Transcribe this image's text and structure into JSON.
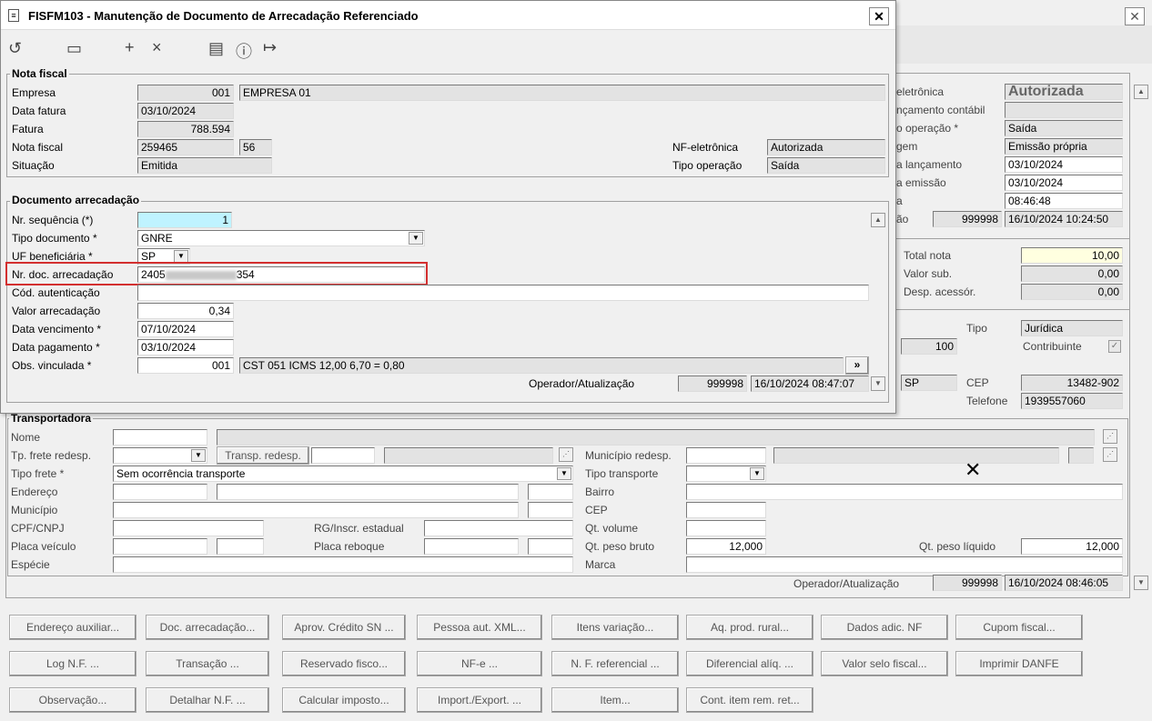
{
  "dialog": {
    "title": "FISFM103 - Manutenção de Documento de Arrecadação Referenciado"
  },
  "nf": {
    "title": "Nota fiscal",
    "empresa_label": "Empresa",
    "empresa_code": "001",
    "empresa_name": "EMPRESA 01",
    "data_fatura_label": "Data fatura",
    "data_fatura": "03/10/2024",
    "fatura_label": "Fatura",
    "fatura": "788.594",
    "nota_label": "Nota fiscal",
    "nota": "259465",
    "serie": "56",
    "situacao_label": "Situação",
    "situacao": "Emitida",
    "nfe_label": "NF-eletrônica",
    "nfe": "Autorizada",
    "tipo_op_label": "Tipo operação",
    "tipo_op": "Saída"
  },
  "doc": {
    "title": "Documento arrecadação",
    "seq_label": "Nr. sequência (*)",
    "seq": "1",
    "tipo_label": "Tipo documento *",
    "tipo": "GNRE",
    "uf_label": "UF beneficiária *",
    "uf": "SP",
    "nr_label": "Nr. doc. arrecadação",
    "nr_a": "2405",
    "nr_b": "354",
    "cod_label": "Cód. autenticação",
    "valor_label": "Valor arrecadação",
    "valor": "0,34",
    "venc_label": "Data vencimento *",
    "venc": "07/10/2024",
    "pag_label": "Data pagamento *",
    "pag": "03/10/2024",
    "obs_label": "Obs. vinculada *",
    "obs_code": "001",
    "obs_text": "CST 051 ICMS 12,00 6,70 = 0,80",
    "more": "»",
    "op_label": "Operador/Atualização",
    "op": "999998",
    "op_date": "16/10/2024 08:47:07"
  },
  "right": {
    "eletr_label": "eletrônica",
    "eletr": "Autorizada",
    "lanc_cont_label": "nçamento contábil",
    "op_label": "o operação *",
    "op": "Saída",
    "origem_label": "gem",
    "origem": "Emissão própria",
    "data_lanc_label": "a lançamento",
    "data_lanc": "03/10/2024",
    "data_em_label": "a emissão",
    "data_em": "03/10/2024",
    "hora_label": "a",
    "hora": "08:46:48",
    "ao_label": "ão",
    "ao_code": "999998",
    "ao_date": "16/10/2024 10:24:50",
    "total_label": "Total nota",
    "total": "10,00",
    "vsub_label": "Valor sub.",
    "vsub": "0,00",
    "desp_label": "Desp. acessór.",
    "desp": "0,00",
    "tipo_label": "Tipo",
    "tipo": "Jurídica",
    "num": "100",
    "contrib_label": "Contribuinte",
    "uf": "SP",
    "cep_label": "CEP",
    "cep": "13482-902",
    "tel_label": "Telefone",
    "tel": "1939557060"
  },
  "transp": {
    "title": "Transportadora",
    "nome": "Nome",
    "tpfrete_redesp": "Tp. frete redesp.",
    "transp_redesp": "Transp. redesp.",
    "mun_redesp": "Município redesp.",
    "tipo_frete": "Tipo frete *",
    "tipo_frete_val": "Sem ocorrência transporte",
    "tipo_transp": "Tipo transporte",
    "endereco": "Endereço",
    "bairro": "Bairro",
    "municipio": "Município",
    "cep": "CEP",
    "cpf": "CPF/CNPJ",
    "rg": "RG/Inscr. estadual",
    "qt_vol": "Qt. volume",
    "placa": "Placa veículo",
    "placa_reb": "Placa reboque",
    "peso_bruto": "Qt. peso bruto",
    "peso_bruto_val": "12,000",
    "peso_liq": "Qt. peso líquido",
    "peso_liq_val": "12,000",
    "especie": "Espécie",
    "marca": "Marca",
    "op_label": "Operador/Atualização",
    "op": "999998",
    "op_date": "16/10/2024 08:46:05"
  },
  "buttons": [
    "Endereço auxiliar...",
    "Doc. arrecadação...",
    "Aprov. Crédito SN ...",
    "Pessoa aut. XML...",
    "Itens variação...",
    "Aq. prod. rural...",
    "Dados adic. NF",
    "Cupom fiscal...",
    "Log N.F. ...",
    "Transação ...",
    "Reservado fisco...",
    "NF-e ...",
    "N. F. referencial ...",
    "Diferencial alíq. ...",
    "Valor selo fiscal...",
    "Imprimir DANFE",
    "Observação...",
    "Detalhar N.F. ...",
    "Calcular imposto...",
    "Import./Export. ...",
    "Item...",
    "Cont. item rem. ret..."
  ]
}
